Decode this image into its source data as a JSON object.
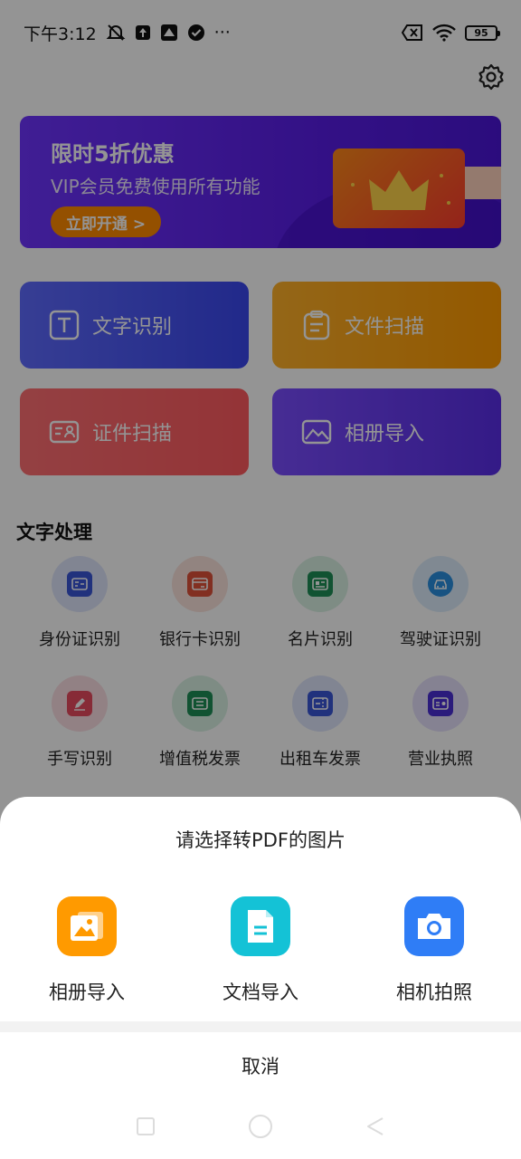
{
  "status_bar": {
    "time": "下午3:12",
    "dots": "···",
    "battery": "95"
  },
  "banner": {
    "title": "限时5折优惠",
    "subtitle": "VIP会员免费使用所有功能",
    "button_label": "立即开通 >"
  },
  "feature_cards": [
    {
      "label": "文字识别",
      "icon": "text-t-icon"
    },
    {
      "label": "文件扫描",
      "icon": "clipboard-icon"
    },
    {
      "label": "证件扫描",
      "icon": "id-card-icon"
    },
    {
      "label": "相册导入",
      "icon": "image-icon"
    }
  ],
  "section": {
    "title": "文字处理",
    "tools": [
      {
        "label": "身份证识别",
        "color": "#3a57d8"
      },
      {
        "label": "银行卡识别",
        "color": "#e0523a"
      },
      {
        "label": "名片识别",
        "color": "#1e8f56"
      },
      {
        "label": "驾驶证识别",
        "color": "#2a8fe0"
      },
      {
        "label": "手写识别",
        "color": "#e84a60"
      },
      {
        "label": "增值税发票",
        "color": "#1e8f56"
      },
      {
        "label": "出租车发票",
        "color": "#3a57d8"
      },
      {
        "label": "营业执照",
        "color": "#4b2fd6"
      }
    ]
  },
  "sheet": {
    "title": "请选择转PDF的图片",
    "options": [
      {
        "label": "相册导入",
        "color": "#ff9a00",
        "icon": "gallery-icon"
      },
      {
        "label": "文档导入",
        "color": "#14c2d6",
        "icon": "document-icon"
      },
      {
        "label": "相机拍照",
        "color": "#2f7df6",
        "icon": "camera-icon"
      }
    ],
    "cancel_label": "取消"
  }
}
